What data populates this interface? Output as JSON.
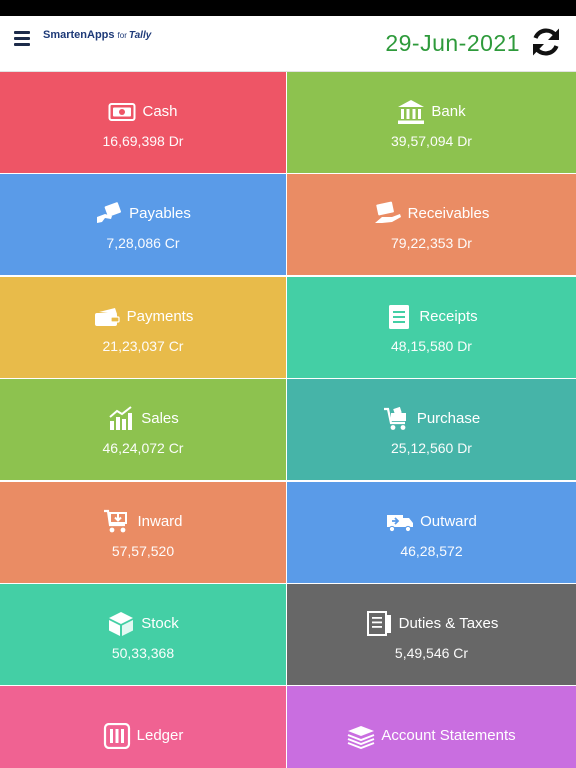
{
  "header": {
    "logo_main": "SmartenApps",
    "logo_for": "for",
    "logo_brand": "Tally",
    "date": "29-Jun-2021"
  },
  "tiles": [
    {
      "label": "Cash",
      "value": "16,69,398 Dr",
      "color": "#ee5566",
      "icon": "cash-icon"
    },
    {
      "label": "Bank",
      "value": "39,57,094 Dr",
      "color": "#8dc24f",
      "icon": "bank-icon"
    },
    {
      "label": "Payables",
      "value": "7,28,086 Cr",
      "color": "#5a9be8",
      "icon": "payables-icon"
    },
    {
      "label": "Receivables",
      "value": "79,22,353 Dr",
      "color": "#ea8c64",
      "icon": "receivables-icon"
    },
    {
      "label": "Payments",
      "value": "21,23,037 Cr",
      "color": "#e8bb4a",
      "icon": "payments-icon"
    },
    {
      "label": "Receipts",
      "value": "48,15,580 Dr",
      "color": "#44cfa5",
      "icon": "receipts-icon"
    },
    {
      "label": "Sales",
      "value": "46,24,072 Cr",
      "color": "#8dc24f",
      "icon": "sales-icon"
    },
    {
      "label": "Purchase",
      "value": "25,12,560 Dr",
      "color": "#46b4a8",
      "icon": "purchase-icon"
    },
    {
      "label": "Inward",
      "value": "57,57,520",
      "color": "#ea8c64",
      "icon": "inward-icon"
    },
    {
      "label": "Outward",
      "value": "46,28,572",
      "color": "#5a9be8",
      "icon": "outward-icon"
    },
    {
      "label": "Stock",
      "value": "50,33,368",
      "color": "#44cfa5",
      "icon": "stock-icon"
    },
    {
      "label": "Duties & Taxes",
      "value": "5,49,546 Cr",
      "color": "#676767",
      "icon": "duties-taxes-icon"
    },
    {
      "label": "Ledger",
      "value": "",
      "color": "#f06292",
      "icon": "ledger-icon"
    },
    {
      "label": "Account Statements",
      "value": "",
      "color": "#c96ee0",
      "icon": "account-statements-icon"
    }
  ]
}
